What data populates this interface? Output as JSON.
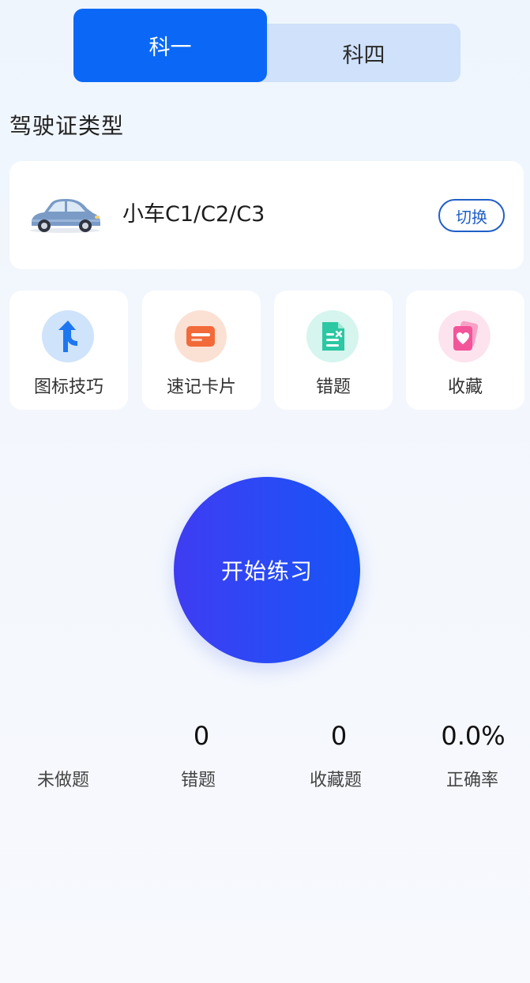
{
  "tabs": {
    "active": "科一",
    "inactive": "科四"
  },
  "section": {
    "title": "驾驶证类型"
  },
  "license": {
    "name": "小车C1/C2/C3",
    "switch_label": "切换",
    "car_color": "#7a9bc6"
  },
  "tiles": [
    {
      "label": "图标技巧",
      "icon": "road-sign-icon",
      "bg": "#cfe3fb",
      "fg": "#1e77f0"
    },
    {
      "label": "速记卡片",
      "icon": "card-icon",
      "bg": "#fbe1d4",
      "fg": "#f26a3a"
    },
    {
      "label": "错题",
      "icon": "wrong-doc-icon",
      "bg": "#d5f5ee",
      "fg": "#2cc7a3"
    },
    {
      "label": "收藏",
      "icon": "heart-card-icon",
      "bg": "#fde3ee",
      "fg": "#f2559a"
    }
  ],
  "start": {
    "label": "开始练习"
  },
  "stats": [
    {
      "value": "",
      "label": "未做题"
    },
    {
      "value": "0",
      "label": "错题"
    },
    {
      "value": "0",
      "label": "收藏题"
    },
    {
      "value": "0.0%",
      "label": "正确率"
    }
  ],
  "colors": {
    "primary": "#0b68f7",
    "tab_bg": "#cfe1fb",
    "start_gradient_start": "#3f3cf2",
    "start_gradient_end": "#1655f6"
  }
}
